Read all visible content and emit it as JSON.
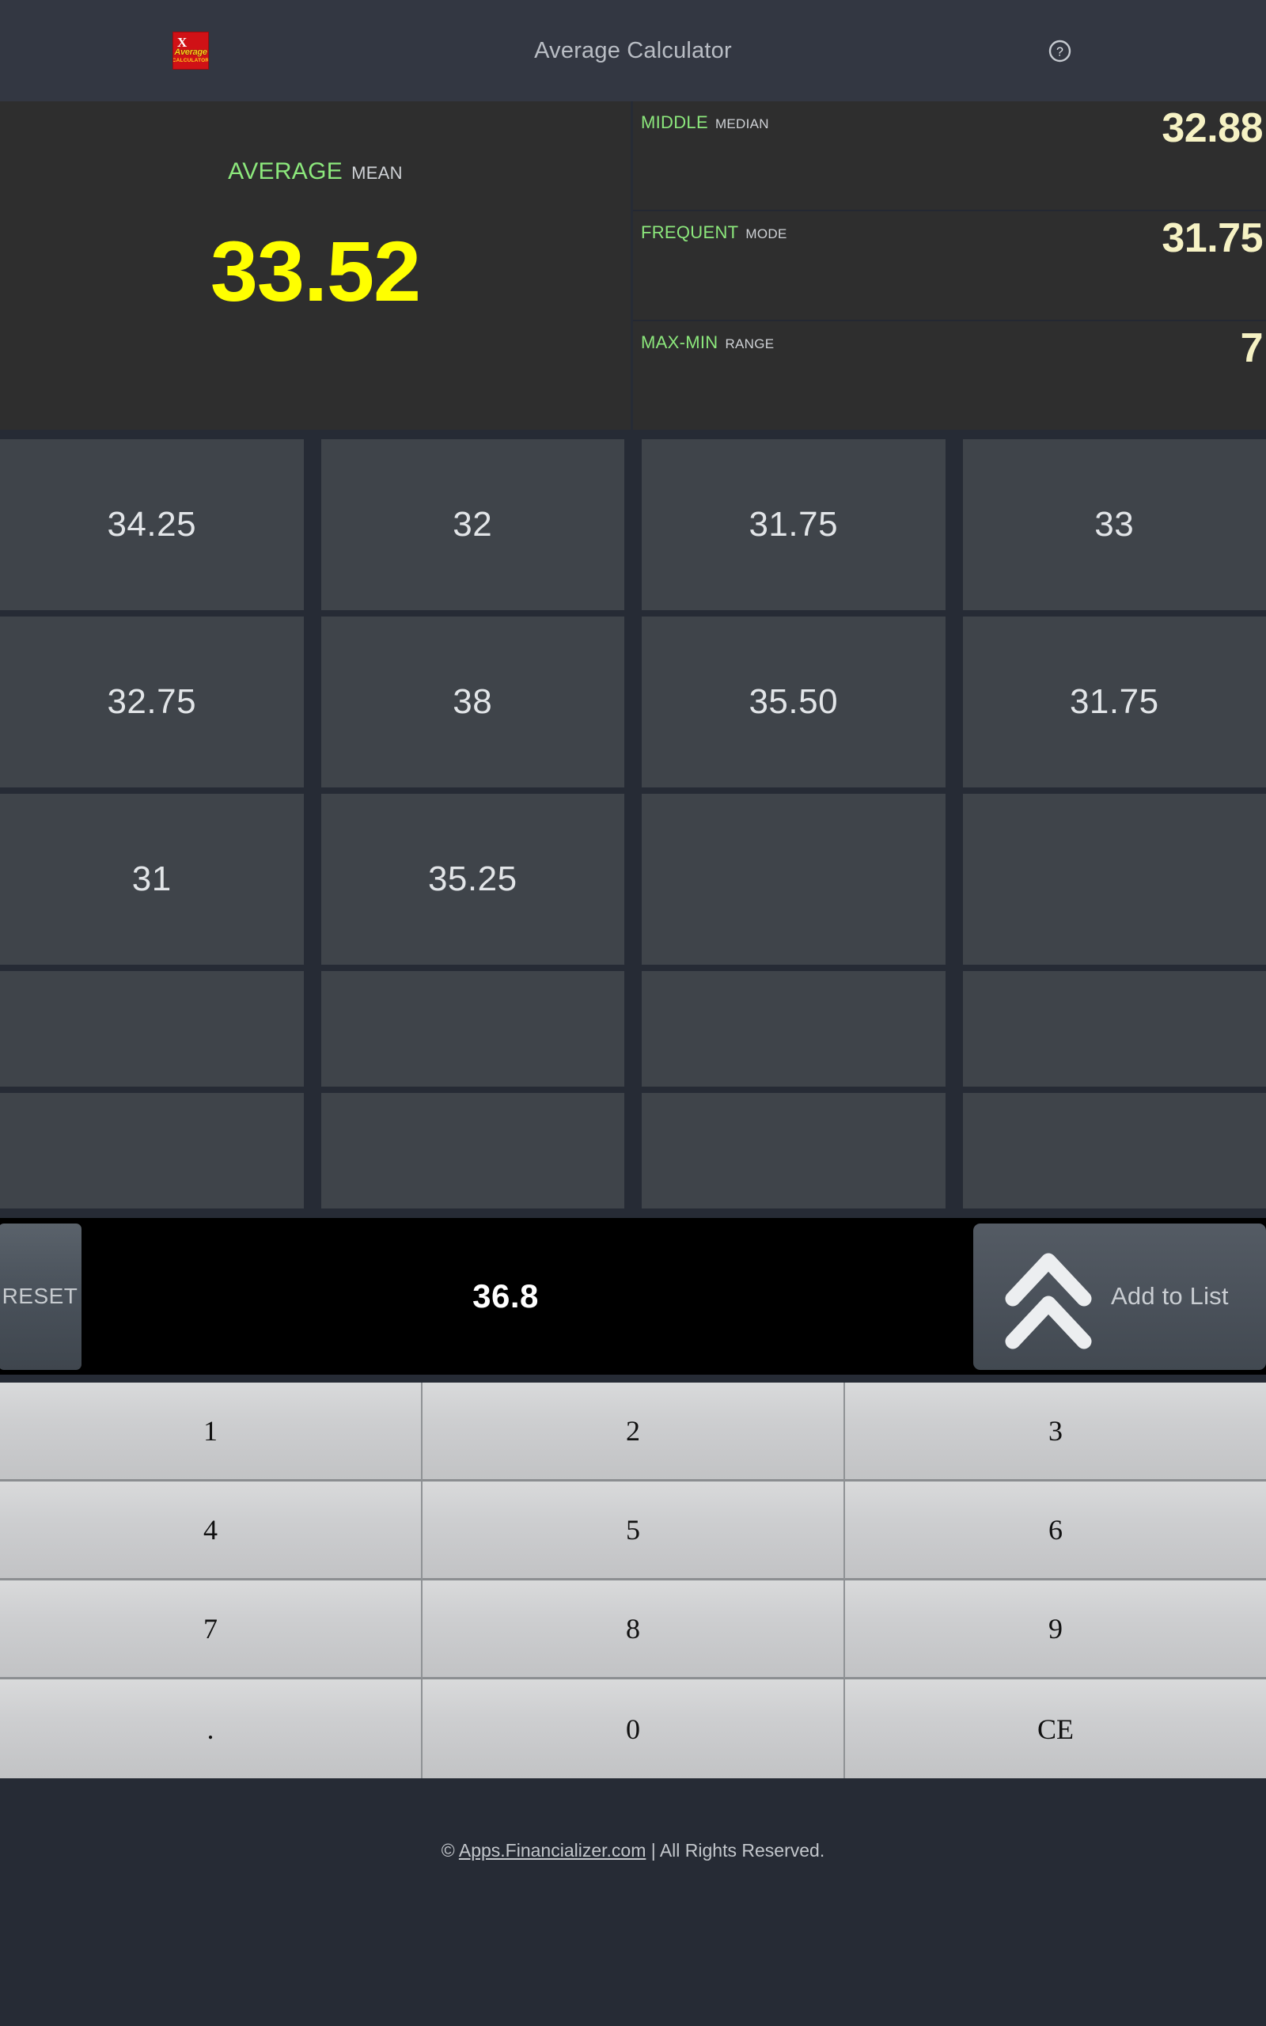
{
  "header": {
    "logo": {
      "mark": "X",
      "word": "Average",
      "sub": "CALCULATOR"
    },
    "title": "Average Calculator",
    "help_icon": "help-circle-icon"
  },
  "results": {
    "mean": {
      "primary_label": "AVERAGE",
      "secondary_label": "MEAN",
      "value": "33.52",
      "value_color": "#ffff00",
      "label_color": "#8ce87c"
    },
    "stats": [
      {
        "primary_label": "MIDDLE",
        "secondary_label": "MEDIAN",
        "value": "32.88"
      },
      {
        "primary_label": "FREQUENT",
        "secondary_label": "MODE",
        "value": "31.75"
      },
      {
        "primary_label": "MAX-MIN",
        "secondary_label": "RANGE",
        "value": "7"
      }
    ]
  },
  "number_grid": {
    "rows": [
      {
        "short": false,
        "cells": [
          "34.25",
          "32",
          "31.75",
          "33"
        ]
      },
      {
        "short": false,
        "cells": [
          "32.75",
          "38",
          "35.50",
          "31.75"
        ]
      },
      {
        "short": false,
        "cells": [
          "31",
          "35.25",
          "",
          ""
        ]
      },
      {
        "short": true,
        "cells": [
          "",
          "",
          "",
          ""
        ]
      },
      {
        "short": true,
        "cells": [
          "",
          "",
          "",
          ""
        ]
      }
    ]
  },
  "entry_bar": {
    "reset_label": "RESET",
    "current_value": "36.8",
    "add_label": "Add to List",
    "add_icon": "double-chevron-up-icon"
  },
  "keypad": {
    "rows": [
      [
        "1",
        "2",
        "3"
      ],
      [
        "4",
        "5",
        "6"
      ],
      [
        "7",
        "8",
        "9"
      ],
      [
        ".",
        "0",
        "CE"
      ]
    ]
  },
  "footer": {
    "copyright_prefix": "© ",
    "link_text": "Apps.Financializer.com",
    "suffix": " | All Rights Reserved."
  }
}
